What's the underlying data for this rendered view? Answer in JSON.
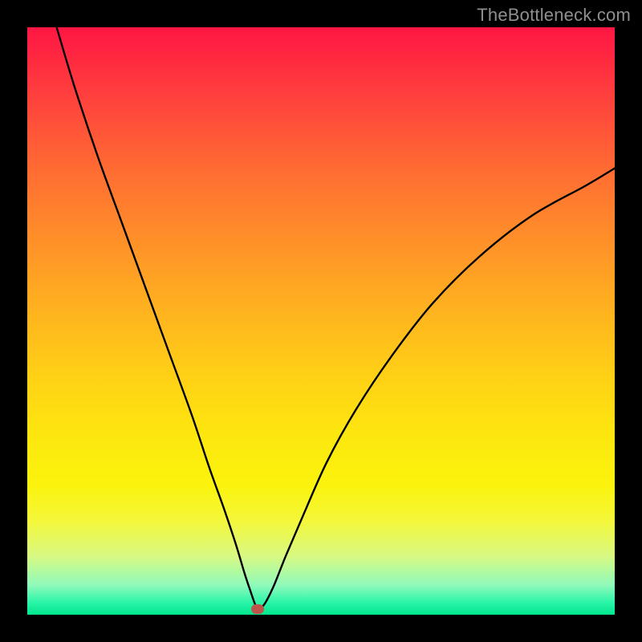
{
  "watermark": {
    "text": "TheBottleneck.com"
  },
  "colors": {
    "gradient_top": "#ff1643",
    "gradient_bottom": "#00e58c",
    "curve": "#000000",
    "marker": "#bd554b",
    "frame": "#000000"
  },
  "chart_data": {
    "type": "line",
    "title": "",
    "xlabel": "",
    "ylabel": "",
    "xlim": [
      0,
      100
    ],
    "ylim": [
      0,
      100
    ],
    "grid": false,
    "series": [
      {
        "name": "bottleneck-curve",
        "x": [
          5,
          8,
          12,
          16,
          20,
          24,
          28,
          31,
          33.5,
          35.5,
          37,
          38,
          38.9,
          39.5,
          40.5,
          42,
          44,
          47,
          51,
          56,
          62,
          69,
          77,
          86,
          95,
          100
        ],
        "y": [
          100,
          90,
          78,
          67,
          56,
          45,
          34,
          25,
          18,
          12,
          7,
          4,
          1.5,
          1,
          2,
          5,
          10,
          17,
          26,
          35,
          44,
          53,
          61,
          68,
          73,
          76
        ]
      }
    ],
    "annotations": [
      {
        "name": "optimal-marker",
        "x": 39.2,
        "y": 1
      }
    ],
    "legend": null
  }
}
